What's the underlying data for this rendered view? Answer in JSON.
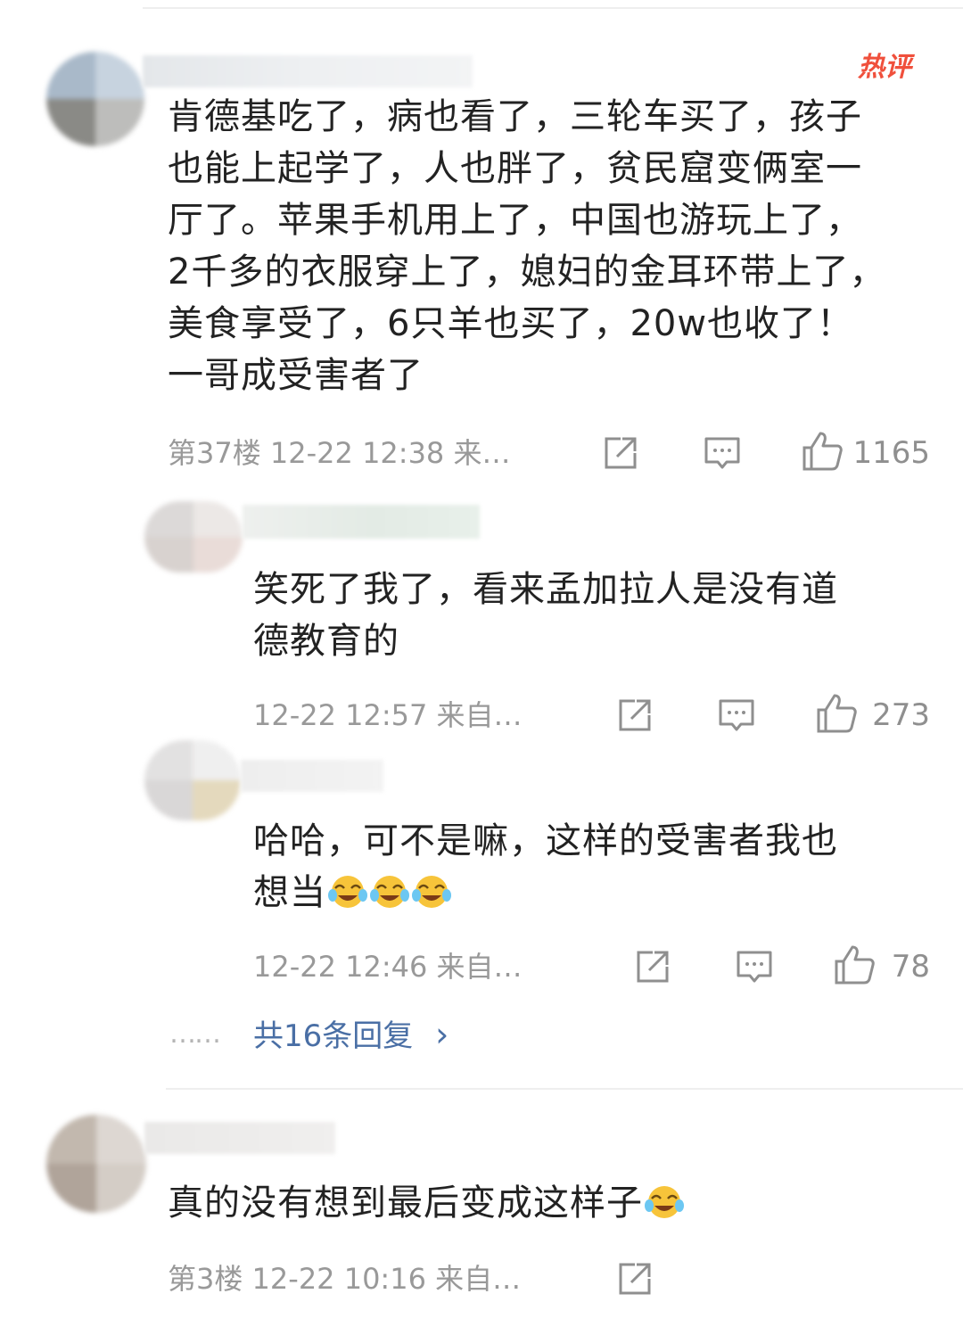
{
  "hot_badge": "热评",
  "comments": [
    {
      "text": "肯德基吃了，病也看了，三轮车买了，孩子也能上起学了，人也胖了，贫民窟变俩室一厅了。苹果手机用上了，中国也游玩上了，2千多的衣服穿上了，媳妇的金耳环带上了，美食享受了，6只羊也买了，20w也收了！一哥成受害者了",
      "lines": [
        "肯德基吃了，病也看了，三轮车买了，孩子",
        "也能上起学了，人也胖了，贫民窟变俩室一",
        "厅了。苹果手机用上了，中国也游玩上了，",
        "2千多的衣服穿上了，媳妇的金耳环带上了，",
        "美食享受了，6只羊也买了，20w也收了！",
        "一哥成受害者了"
      ],
      "floor": "第37楼",
      "time": "12-22 12:38",
      "source": "来…",
      "likes": "1165"
    },
    {
      "lines": [
        "笑死了我了，看来孟加拉人是没有道",
        "德教育的"
      ],
      "time": "12-22 12:57",
      "source": "来自…",
      "likes": "273"
    },
    {
      "lines": [
        "哈哈，可不是嘛，这样的受害者我也",
        "想当"
      ],
      "time": "12-22 12:46",
      "source": "来自…",
      "likes": "78"
    },
    {
      "lines": [
        "真的没有想到最后变成这样子"
      ],
      "floor": "第3楼",
      "time": "12-22 10:16",
      "source": "来自…"
    }
  ],
  "replies": {
    "dots": "……",
    "label": "共16条回复",
    "chevron": "›"
  },
  "icons": [
    "share-icon",
    "comment-icon",
    "like-icon",
    "crying-laughing-emoji"
  ],
  "colors": {
    "hot_badge": "#f0503c",
    "link": "#4a6fa5",
    "meta": "#999999",
    "text": "#222222"
  }
}
